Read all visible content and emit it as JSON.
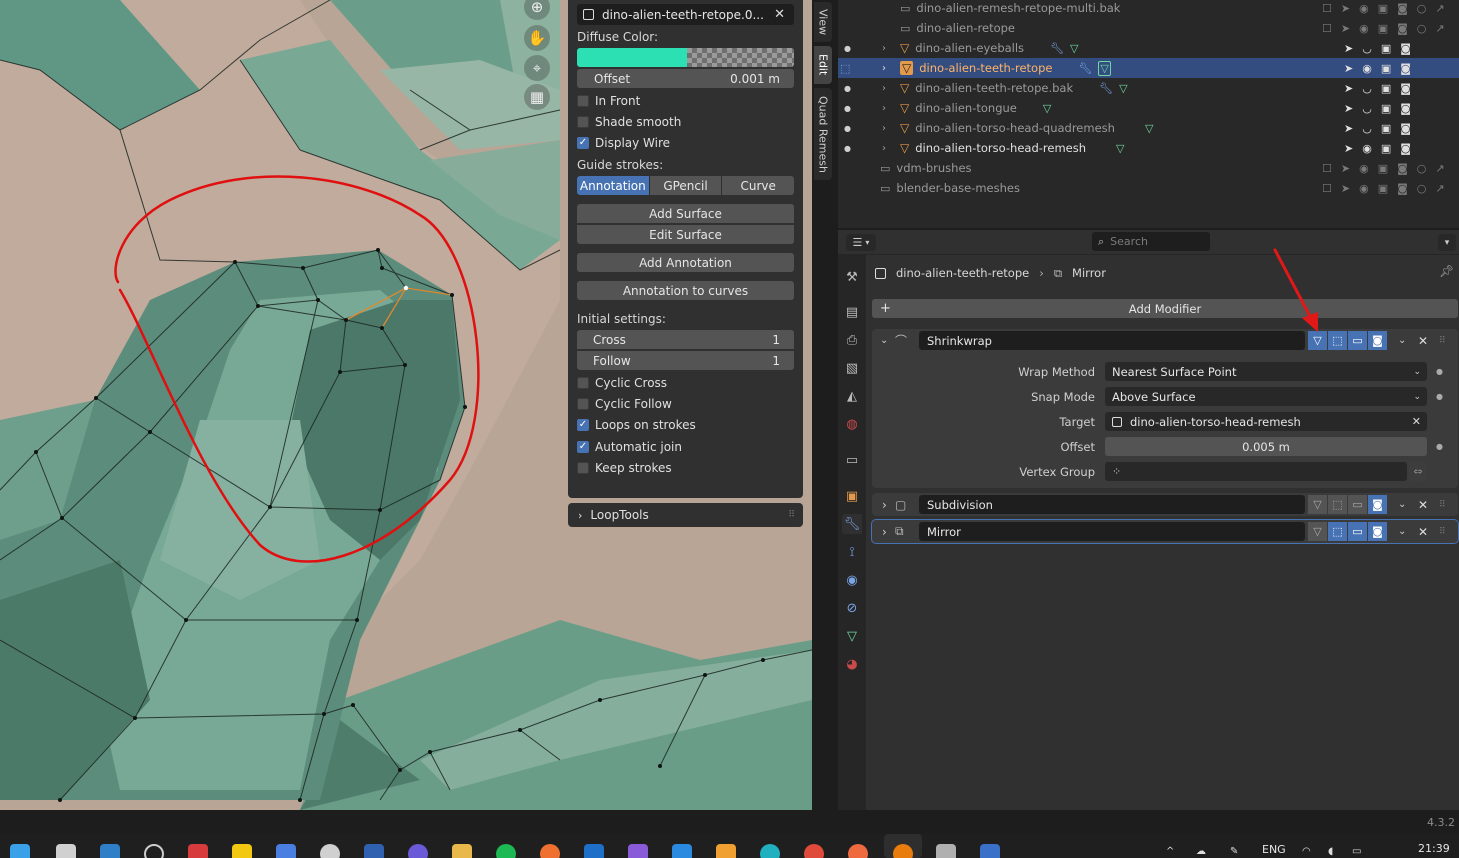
{
  "npanel": {
    "object_name": "dino-alien-teeth-retope.0...",
    "diffuse_color_label": "Diffuse Color:",
    "diffuse_color": "#2de0b4",
    "offset_label": "Offset",
    "offset_value": "0.001 m",
    "in_front_label": "In Front",
    "in_front_checked": false,
    "shade_smooth_label": "Shade smooth",
    "shade_smooth_checked": false,
    "display_wire_label": "Display Wire",
    "display_wire_checked": true,
    "guide_strokes_label": "Guide strokes:",
    "guide_tabs": [
      "Annotation",
      "GPencil",
      "Curve"
    ],
    "guide_active": "Annotation",
    "add_surface": "Add Surface",
    "edit_surface": "Edit Surface",
    "add_annotation": "Add Annotation",
    "annotation_to_curves": "Annotation to curves",
    "initial_settings_label": "Initial settings:",
    "cross_label": "Cross",
    "cross_value": "1",
    "follow_label": "Follow",
    "follow_value": "1",
    "cyclic_cross_label": "Cyclic Cross",
    "cyclic_follow_label": "Cyclic Follow",
    "loops_on_strokes_label": "Loops on strokes",
    "automatic_join_label": "Automatic join",
    "keep_strokes_label": "Keep strokes",
    "looptools_label": "LoopTools"
  },
  "side_tabs": [
    "View",
    "Edit",
    "Quad Remesh"
  ],
  "outliner": {
    "rows": [
      {
        "name": "dino-alien-remesh-retope-multi.bak",
        "type": "collection",
        "visible": false
      },
      {
        "name": "dino-alien-retope",
        "type": "collection",
        "visible": false
      },
      {
        "name": "dino-alien-eyeballs",
        "type": "mesh",
        "visible": true
      },
      {
        "name": "dino-alien-teeth-retope",
        "type": "mesh",
        "visible": true,
        "selected": true
      },
      {
        "name": "dino-alien-teeth-retope.bak",
        "type": "mesh",
        "visible": true
      },
      {
        "name": "dino-alien-tongue",
        "type": "mesh",
        "visible": true
      },
      {
        "name": "dino-alien-torso-head-quadremesh",
        "type": "mesh",
        "visible": true
      },
      {
        "name": "dino-alien-torso-head-remesh",
        "type": "mesh",
        "visible": true
      },
      {
        "name": "vdm-brushes",
        "type": "collection",
        "visible": false
      },
      {
        "name": "blender-base-meshes",
        "type": "collection",
        "visible": false
      }
    ]
  },
  "properties": {
    "search_placeholder": "Search",
    "breadcrumb_object": "dino-alien-teeth-retope",
    "breadcrumb_modifier": "Mirror",
    "add_modifier": "Add Modifier",
    "modifiers": [
      {
        "name": "Shrinkwrap",
        "expanded": true
      },
      {
        "name": "Subdivision",
        "expanded": false
      },
      {
        "name": "Mirror",
        "expanded": false
      }
    ],
    "shrinkwrap": {
      "wrap_method_label": "Wrap Method",
      "wrap_method_value": "Nearest Surface Point",
      "snap_mode_label": "Snap Mode",
      "snap_mode_value": "Above Surface",
      "target_label": "Target",
      "target_value": "dino-alien-torso-head-remesh",
      "offset_label": "Offset",
      "offset_value": "0.005 m",
      "vertex_group_label": "Vertex Group",
      "vertex_group_value": ""
    }
  },
  "status": {
    "version": "4.3.2"
  },
  "taskbar": {
    "language": "ENG",
    "time": "21:39"
  },
  "colors": {
    "accent": "#4772b3",
    "selected_row": "#334d80",
    "annotation": "#e01010",
    "arrow": "#e01818"
  }
}
